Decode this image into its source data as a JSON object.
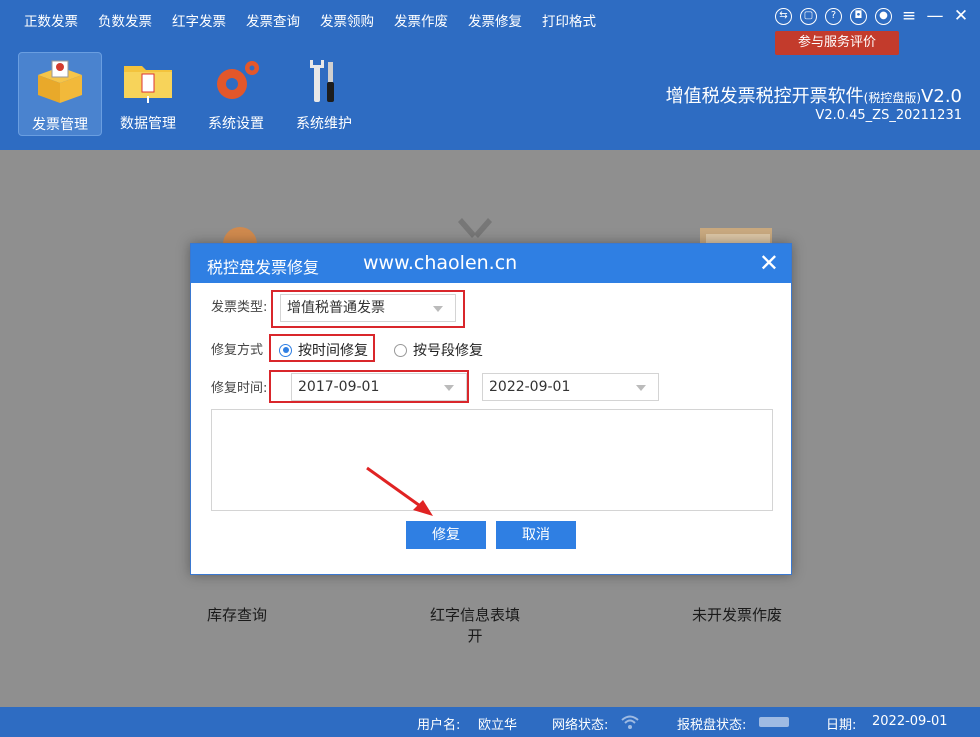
{
  "menu": [
    "正数发票",
    "负数发票",
    "红字发票",
    "发票查询",
    "发票领购",
    "发票作废",
    "发票修复",
    "打印格式"
  ],
  "rate_badge": "参与服务评价",
  "toolbar": [
    {
      "label": "发票管理",
      "icon": "box-icon"
    },
    {
      "label": "数据管理",
      "icon": "folder-icon"
    },
    {
      "label": "系统设置",
      "icon": "gear-icon"
    },
    {
      "label": "系统维护",
      "icon": "tools-icon"
    }
  ],
  "brand": {
    "title": "增值税发票税控开票软件",
    "edition": "(税控盘版)",
    "suffix": "V2.0",
    "version": "V2.0.45_ZS_20211231"
  },
  "background_items": {
    "inventory": "库存查询",
    "red_info_line1": "红字信息表填",
    "red_info_line2": "开",
    "void_unissued": "未开发票作废"
  },
  "dialog": {
    "title": "税控盘发票修复",
    "watermark": "www.chaolen.cn",
    "invoice_type_label": "发票类型:",
    "invoice_type_value": "增值税普通发票",
    "repair_mode_label": "修复方式",
    "mode_by_time": "按时间修复",
    "mode_by_number": "按号段修复",
    "repair_time_label": "修复时间:",
    "start_date": "2017-09-01",
    "end_date": "2022-09-01",
    "repair_button": "修复",
    "cancel_button": "取消"
  },
  "status": {
    "user_label": "用户名:",
    "user_value": "欧立华",
    "network_label": "网络状态:",
    "taxdisk_label": "报税盘状态:",
    "date_label": "日期:",
    "date_value": "2022-09-01"
  },
  "colors": {
    "header": "#2e6cc2",
    "dialog_title": "#2f7fe3",
    "highlight": "#d9262b",
    "badge": "#c33b2c"
  }
}
